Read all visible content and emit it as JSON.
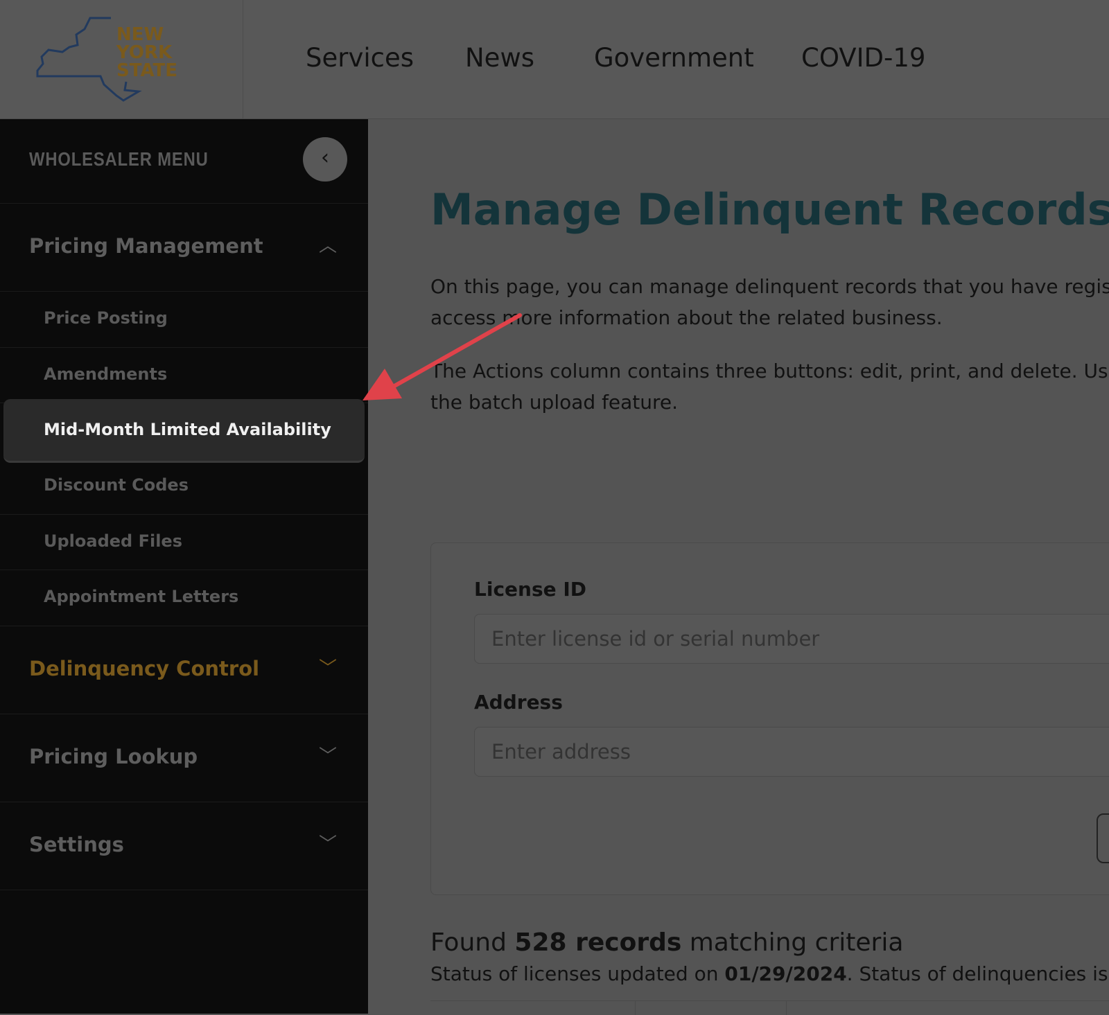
{
  "header": {
    "logo_text": "NEW YORK STATE",
    "nav": [
      "Services",
      "News",
      "Government",
      "COVID-19"
    ]
  },
  "sidebar": {
    "title": "WHOLESALER MENU",
    "groups": [
      {
        "label": "Pricing Management",
        "expanded": true,
        "items": [
          "Price Posting",
          "Amendments",
          "Mid-Month Limited Availability",
          "Discount Codes",
          "Uploaded Files",
          "Appointment Letters"
        ],
        "active": "Mid-Month Limited Availability"
      },
      {
        "label": "Delinquency Control",
        "color": "#7a5a1c"
      },
      {
        "label": "Pricing Lookup"
      },
      {
        "label": "Settings"
      }
    ]
  },
  "main": {
    "title": "Manage Delinquent Records",
    "p1a": "On this page, you can manage delinquent records that you have registere",
    "p1b": "access more information about the related business.",
    "p2a": "The Actions column contains three buttons: edit, print, and delete. Use th",
    "p2b": "the batch upload feature.",
    "license_label": "License ID",
    "license_placeholder": "Enter license id or serial number",
    "address_label": "Address",
    "address_placeholder": "Enter address",
    "found_pre": "Found ",
    "found_count": "528 records",
    "found_post": " matching criteria",
    "status_pre": "Status of licenses updated on ",
    "status_date": "01/29/2024",
    "status_post": ". Status of delinquencies is cur"
  },
  "colors": {
    "arrow": "#e0424a",
    "title": "#14343a"
  }
}
